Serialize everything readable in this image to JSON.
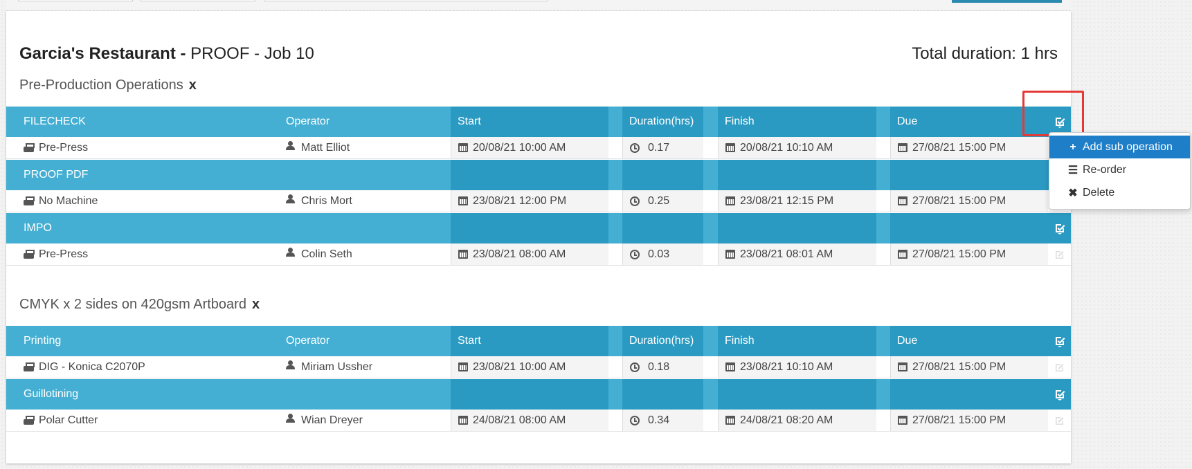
{
  "header": {
    "customer": "Garcia's Restaurant -",
    "job": "PROOF - Job 10",
    "total_duration": "Total duration: 1 hrs"
  },
  "columns": {
    "operator": "Operator",
    "start": "Start",
    "duration": "Duration(hrs)",
    "finish": "Finish",
    "due": "Due"
  },
  "sections": [
    {
      "label": "Pre-Production Operations",
      "remove": "x",
      "operations": [
        {
          "name": "FILECHECK",
          "machine": "Pre-Press",
          "operator": "Matt Elliot",
          "start": "20/08/21 10:00 AM",
          "duration": "0.17",
          "finish": "20/08/21 10:10 AM",
          "due": "27/08/21 15:00 PM"
        },
        {
          "name": "PROOF PDF",
          "machine": "No Machine",
          "operator": "Chris Mort",
          "start": "23/08/21 12:00 PM",
          "duration": "0.25",
          "finish": "23/08/21 12:15 PM",
          "due": "27/08/21 15:00 PM"
        },
        {
          "name": "IMPO",
          "machine": "Pre-Press",
          "operator": "Colin Seth",
          "start": "23/08/21 08:00 AM",
          "duration": "0.03",
          "finish": "23/08/21 08:01 AM",
          "due": "27/08/21 15:00 PM"
        }
      ]
    },
    {
      "label": "CMYK x 2 sides on 420gsm Artboard",
      "remove": "x",
      "operations": [
        {
          "name": "Printing",
          "machine": "DIG - Konica C2070P",
          "operator": "Miriam Ussher",
          "start": "23/08/21 10:00 AM",
          "duration": "0.18",
          "finish": "23/08/21 10:10 AM",
          "due": "27/08/21 15:00 PM"
        },
        {
          "name": "Guillotining",
          "machine": "Polar Cutter",
          "operator": "Wian Dreyer",
          "start": "24/08/21 08:00 AM",
          "duration": "0.34",
          "finish": "24/08/21 08:20 AM",
          "due": "27/08/21 15:00 PM"
        }
      ]
    }
  ],
  "dropdown": {
    "items": [
      {
        "label": "Add sub operation",
        "icon": "plus-icon"
      },
      {
        "label": "Re-order",
        "icon": "list-icon"
      },
      {
        "label": "Delete",
        "icon": "times-icon"
      }
    ]
  },
  "colors": {
    "header_light": "#45afd3",
    "header_dark": "#2b9ac2",
    "menu_active": "#1e7ec8",
    "highlight": "#e53935"
  }
}
